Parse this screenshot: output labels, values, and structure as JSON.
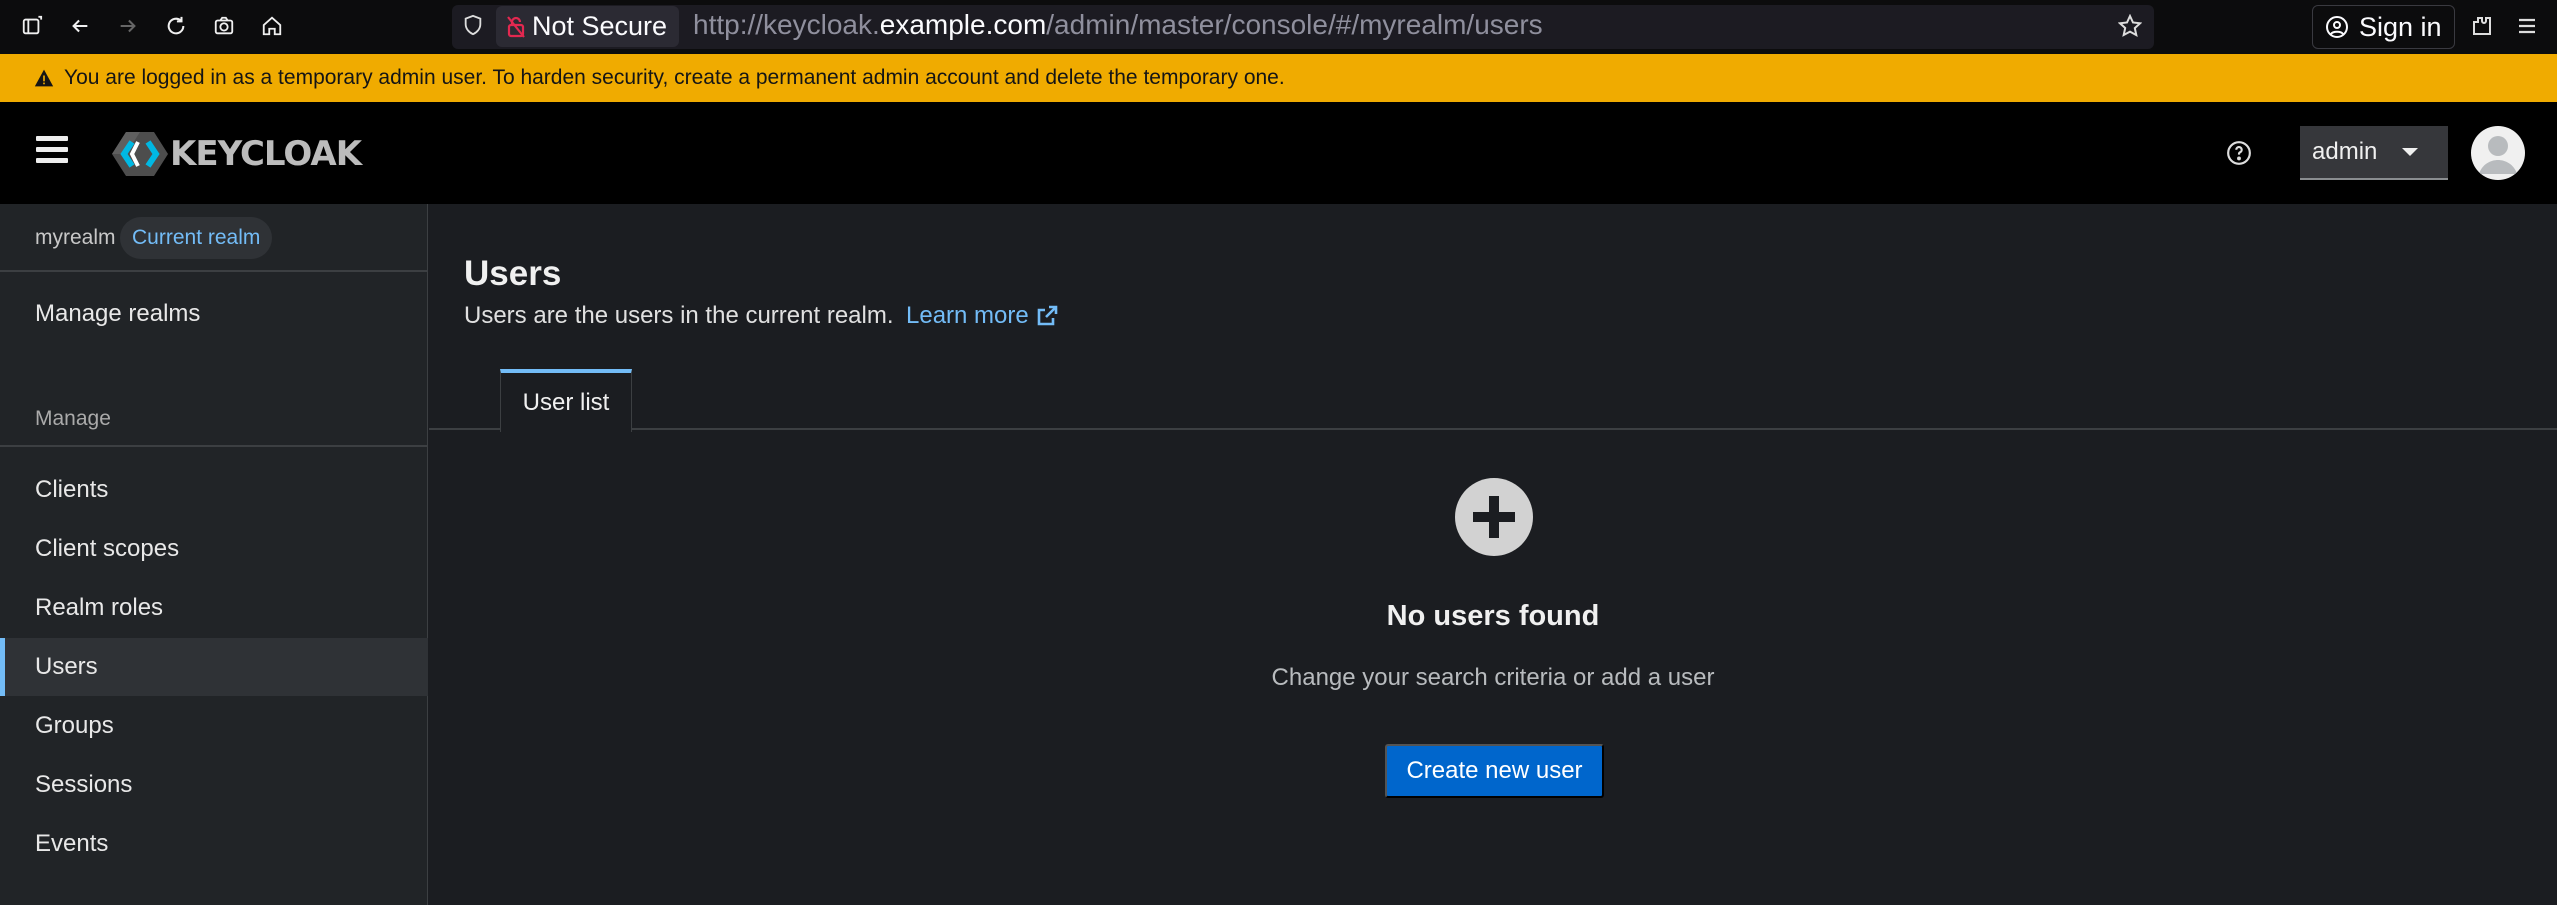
{
  "browser": {
    "not_secure_label": "Not Secure",
    "url_prefix": "http://keycloak.",
    "url_host": "example.com",
    "url_path": "/admin/master/console/#/myrealm/users",
    "sign_in_label": "Sign in"
  },
  "banner": {
    "message": "You are logged in as a temporary admin user. To harden security, create a permanent admin account and delete the temporary one."
  },
  "masthead": {
    "logo_text": "KEYCLOAK",
    "user_menu_label": "admin"
  },
  "sidebar": {
    "realm_name": "myrealm",
    "realm_badge": "Current realm",
    "manage_realms": "Manage realms",
    "section_title": "Manage",
    "items": [
      {
        "label": "Clients"
      },
      {
        "label": "Client scopes"
      },
      {
        "label": "Realm roles"
      },
      {
        "label": "Users"
      },
      {
        "label": "Groups"
      },
      {
        "label": "Sessions"
      },
      {
        "label": "Events"
      }
    ],
    "active_item": "Users"
  },
  "main": {
    "title": "Users",
    "description": "Users are the users in the current realm.",
    "learn_more": "Learn more",
    "tabs": [
      {
        "label": "User list"
      }
    ],
    "empty_state": {
      "title": "No users found",
      "body": "Change your search criteria or add a user",
      "button": "Create new user"
    }
  },
  "colors": {
    "banner": "#f0ab00",
    "link": "#73bcf7",
    "primary_button": "#0066cc"
  }
}
